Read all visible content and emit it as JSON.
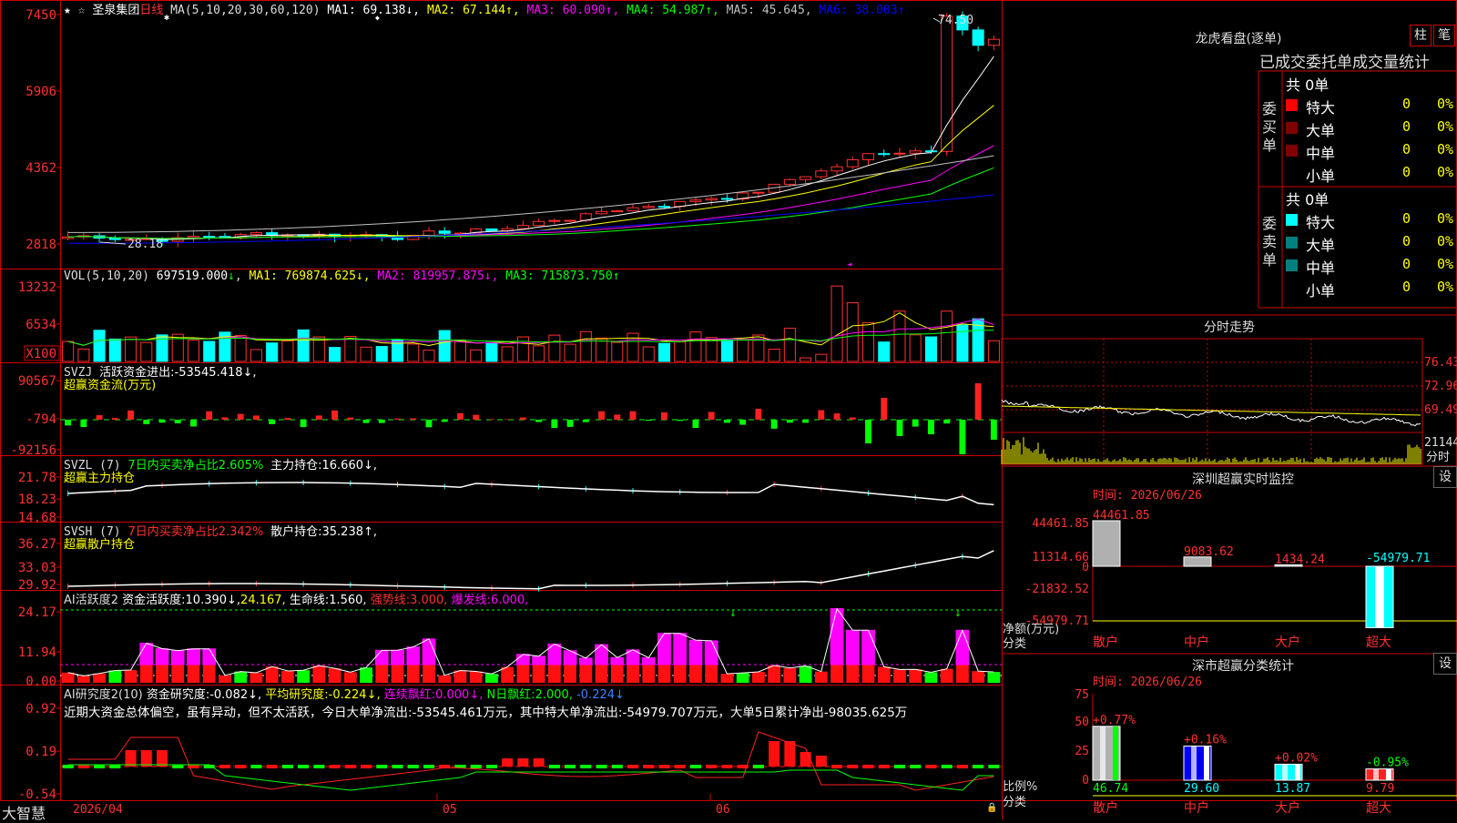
{
  "stock": {
    "name": "圣泉集团",
    "period": "日线"
  },
  "panels": {
    "price": {
      "header": "MA(5,10,20,30,60,120)",
      "ma": [
        {
          "label": "MA1:",
          "value": "69.138",
          "arrow": "↓",
          "color": "#ffffff"
        },
        {
          "label": "MA2:",
          "value": "67.144",
          "arrow": "↑",
          "color": "#ffff00"
        },
        {
          "label": "MA3:",
          "value": "60.090",
          "arrow": "↑",
          "color": "#ff00ff"
        },
        {
          "label": "MA4:",
          "value": "54.987",
          "arrow": "↑",
          "color": "#00ff00"
        },
        {
          "label": "MA5:",
          "value": "45.645",
          "arrow": "",
          "color": "#c0c0c0"
        },
        {
          "label": "MA6:",
          "value": "38.003",
          "arrow": "↑",
          "color": "#0000ff"
        }
      ],
      "yticks": [
        "7450",
        "5906",
        "4362",
        "2818"
      ],
      "high_label": "74.50",
      "low_label": "28.18"
    },
    "vol": {
      "header": "VOL(5,10,20)",
      "value": "697519.000",
      "arrow": "↓",
      "ma": [
        {
          "label": "MA1:",
          "value": "769874.625",
          "arrow": "↓",
          "color": "#ffff00"
        },
        {
          "label": "MA2:",
          "value": "819957.875",
          "arrow": "↓",
          "color": "#ff00ff"
        },
        {
          "label": "MA3:",
          "value": "715873.750",
          "arrow": "↑",
          "color": "#00ff00"
        }
      ],
      "yticks": [
        "13232",
        "6534"
      ],
      "unit": "X100"
    },
    "svzj": {
      "header": "SVZJ",
      "line1": "活跃资金进出:-53545.418↓,",
      "line2": "超赢资金流(万元)",
      "yticks": [
        "90567",
        "-794",
        "-92156"
      ]
    },
    "svzl": {
      "header": "SVZL (7)",
      "text1": "7日内买卖净占比2.605%",
      "text2": "主力持仓:16.660↓,",
      "line2": "超赢主力持仓",
      "yticks": [
        "21.78",
        "18.23",
        "14.68"
      ]
    },
    "svsh": {
      "header": "SVSH (7)",
      "text1": "7日内买卖净占比2.342%",
      "text2": "散户持仓:35.238↑,",
      "line2": "超赢散户持仓",
      "yticks": [
        "36.27",
        "33.03",
        "29.92"
      ]
    },
    "ai1": {
      "header": "AI活跃度2",
      "t1": "资金活跃度:10.390↓,",
      "t2": "24.167,",
      "t3": "生命线:1.560,",
      "t4": "强势线:3.000,",
      "t5": "爆发线:6.000,",
      "yticks": [
        "24.17",
        "11.94",
        "0.00"
      ]
    },
    "ai2": {
      "header": "AI研究度2(10)",
      "t1": "资金研究度:-0.082↓,",
      "t2": "平均研究度:-0.224↓,",
      "t3": "连续飘红:0.000↓,",
      "t4": "N日飘红:2.000,",
      "t5": "-0.224↓",
      "comment": "近期大资金总体偏空，虽有异动，但不太活跃，今日大单净流出:-53545.461万元，其中特大单净流出:-54979.707万元，大单5日累计净出-98035.625万",
      "yticks": [
        "0.92",
        "0.19",
        "-0.54"
      ]
    }
  },
  "xaxis": {
    "labels": [
      "2026/04",
      "05",
      "06"
    ]
  },
  "brand": "大智慧",
  "right": {
    "dragon": {
      "title": "龙虎看盘(逐单)",
      "btn_column": "柱",
      "btn_stroke": "笔",
      "subtitle": "已成交委托单成交量统计",
      "buy": {
        "side": "委买单",
        "total": "共 0单",
        "rows": [
          {
            "label": "特大",
            "count": "0",
            "pct": "0%",
            "color": "#ff0000"
          },
          {
            "label": "大单",
            "count": "0",
            "pct": "0%",
            "color": "#800000"
          },
          {
            "label": "中单",
            "count": "0",
            "pct": "0%",
            "color": "#800000"
          },
          {
            "label": "小单",
            "count": "0",
            "pct": "0%",
            "color": ""
          }
        ]
      },
      "sell": {
        "side": "委卖单",
        "total": "共 0单",
        "rows": [
          {
            "label": "特大",
            "count": "0",
            "pct": "0%",
            "color": "#00ffff"
          },
          {
            "label": "大单",
            "count": "0",
            "pct": "0%",
            "color": "#008080"
          },
          {
            "label": "中单",
            "count": "0",
            "pct": "0%",
            "color": "#008080"
          },
          {
            "label": "小单",
            "count": "0",
            "pct": "0%",
            "color": ""
          }
        ]
      }
    },
    "intraday": {
      "title": "分时走势",
      "yticks": [
        "76.43",
        "72.96",
        "69.49"
      ],
      "vol_label": "21144",
      "footer": "分时"
    },
    "monitor": {
      "title": "深圳超赢实时监控",
      "btn": "设",
      "time": "时间: 2026/06/26",
      "yticks": [
        "44461.85",
        "11314.66",
        "0",
        "-21832.52",
        "-54979.71"
      ],
      "net_label": "净额(万元)",
      "cat_label": "分类",
      "bars": [
        {
          "cat": "散户",
          "value": "44461.85"
        },
        {
          "cat": "中户",
          "value": "9083.62"
        },
        {
          "cat": "大户",
          "value": "1434.24"
        },
        {
          "cat": "超大",
          "value": "-54979.71"
        }
      ]
    },
    "stats": {
      "title": "深市超赢分类统计",
      "btn": "设",
      "time": "时间: 2026/06/26",
      "yticks": [
        "75",
        "50",
        "25",
        "0"
      ],
      "ratio_label": "比例%",
      "cat_label": "分类",
      "bars": [
        {
          "cat": "散户",
          "pct": "+0.77%",
          "value": "46.74"
        },
        {
          "cat": "中户",
          "pct": "+0.16%",
          "value": "29.60"
        },
        {
          "cat": "大户",
          "pct": "+0.02%",
          "value": "13.87"
        },
        {
          "cat": "超大",
          "pct": "-0.95%",
          "value": "9.79"
        }
      ]
    }
  }
}
